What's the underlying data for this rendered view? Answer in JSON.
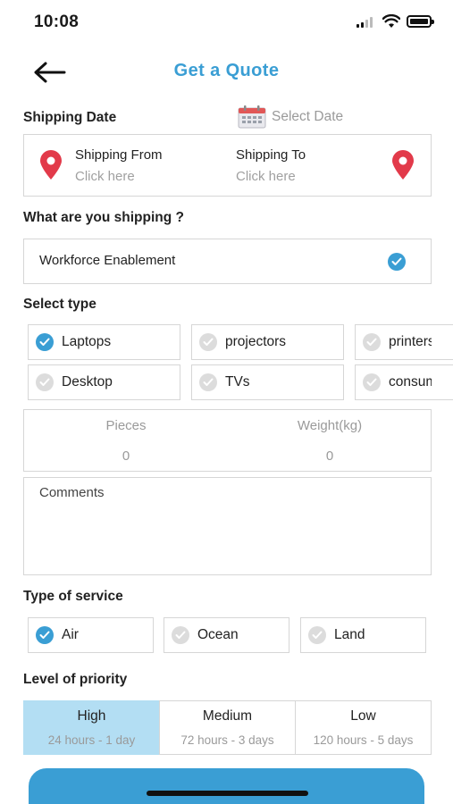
{
  "status": {
    "time": "10:08"
  },
  "header": {
    "title": "Get a Quote"
  },
  "shipping_date": {
    "label": "Shipping Date",
    "placeholder": "Select Date"
  },
  "route": {
    "from_label": "Shipping From",
    "from_value": "Click here",
    "to_label": "Shipping To",
    "to_value": "Click here"
  },
  "what_shipping": {
    "label": "What are you shipping ?",
    "value": "Workforce Enablement"
  },
  "select_type": {
    "label": "Select type",
    "row1": [
      {
        "label": "Laptops",
        "checked": true
      },
      {
        "label": "projectors",
        "checked": false
      },
      {
        "label": "printers",
        "checked": false
      }
    ],
    "row2": [
      {
        "label": "Desktop",
        "checked": false
      },
      {
        "label": "TVs",
        "checked": false
      },
      {
        "label": "consumables",
        "checked": false
      }
    ]
  },
  "metrics": {
    "pieces_label": "Pieces",
    "pieces_value": "0",
    "weight_label": "Weight(kg)",
    "weight_value": "0"
  },
  "comments": {
    "placeholder": "Comments"
  },
  "service": {
    "label": "Type of service",
    "options": [
      {
        "label": "Air",
        "checked": true
      },
      {
        "label": "Ocean",
        "checked": false
      },
      {
        "label": "Land",
        "checked": false
      }
    ]
  },
  "priority": {
    "label": "Level of priority",
    "options": [
      {
        "name": "High",
        "time": "24 hours - 1 day",
        "selected": true
      },
      {
        "name": "Medium",
        "time": "72 hours - 3 days",
        "selected": false
      },
      {
        "name": "Low",
        "time": "120 hours - 5 days",
        "selected": false
      }
    ]
  },
  "colors": {
    "accent": "#3a9ed4",
    "pin": "#e23a4a",
    "selected_bg": "#b3def3"
  }
}
